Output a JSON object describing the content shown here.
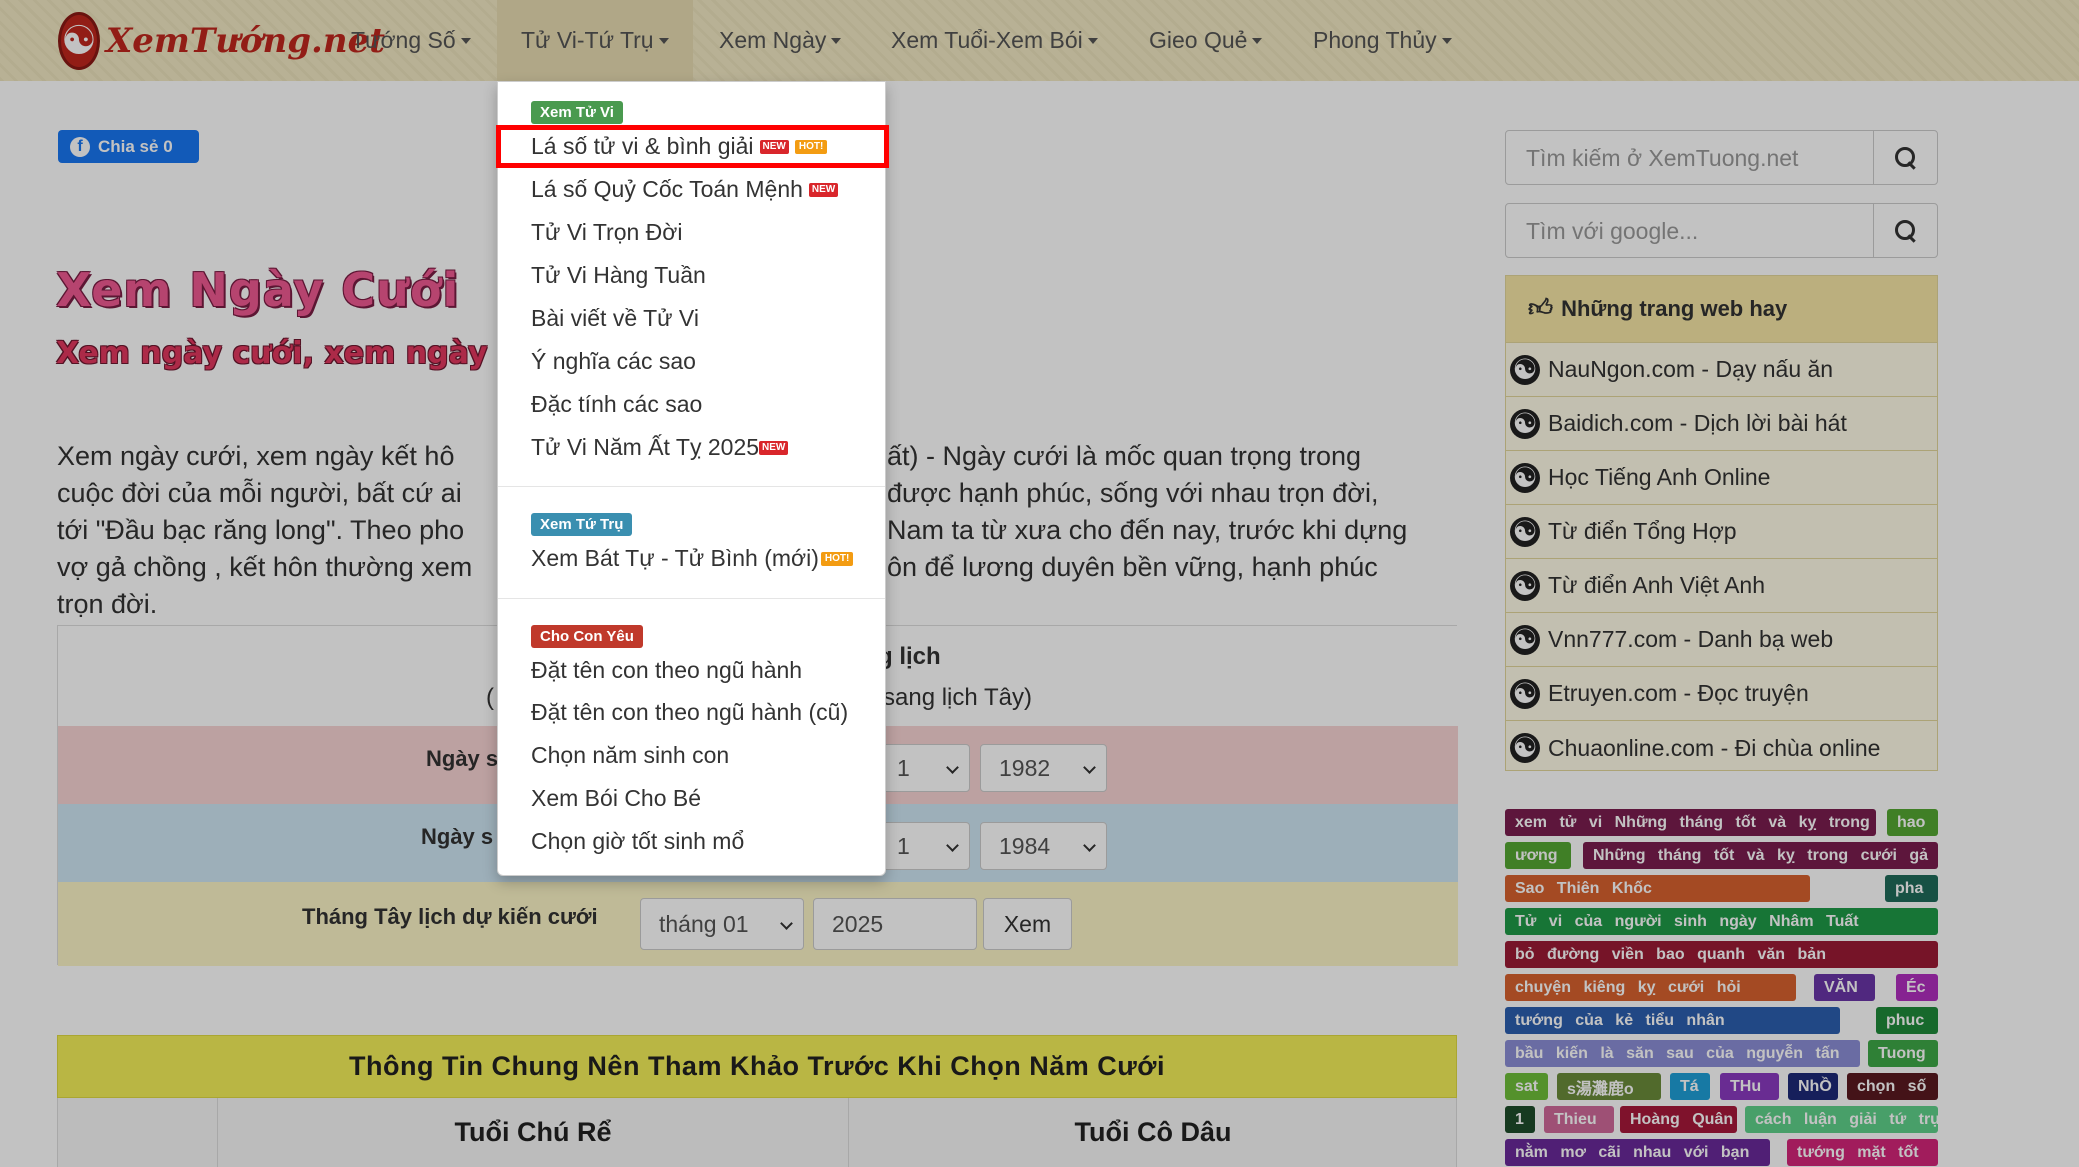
{
  "nav": {
    "logo_text": "XemTướng.net",
    "items": [
      {
        "label": "Tướng Số"
      },
      {
        "label": "Tử Vi-Tứ Trụ"
      },
      {
        "label": "Xem Ngày"
      },
      {
        "label": "Xem Tuổi-Xem Bói"
      },
      {
        "label": "Gieo Quẻ"
      },
      {
        "label": "Phong Thủy"
      }
    ]
  },
  "share": {
    "label": "Chia sẻ 0"
  },
  "page": {
    "title": "Xem Ngày Cưới",
    "subtitle": "Xem ngày cưới, xem ngày kết",
    "intro_lines": [
      "Xem ngày cưới, xem ngày kết hô",
      "cuộc đời của mỗi người, bất cứ ai",
      "tới \"Đầu bạc răng long\". Theo pho",
      "vợ gả chồng , kết hôn thường xem",
      "trọn đời."
    ],
    "intro_right_lines": [
      "ất) - Ngày cưới là mốc quan trọng trong",
      "được hạnh phúc, sống với nhau trọn đời,",
      "Nam ta từ xưa cho đến nay, trước khi dựng",
      "ôn để lương duyên bền vững, hạnh phúc"
    ]
  },
  "form": {
    "head_title": "g lịch",
    "head_note_left": "(",
    "head_note_right": "sang lịch Tây)",
    "groom_label": "Ngày s",
    "groom_month": "1",
    "groom_year": "1982",
    "bride_label": "Ngày s",
    "bride_month": "1",
    "bride_year": "1984",
    "date_label": "Tháng Tây lịch dự kiến cưới",
    "date_month": "tháng 01",
    "date_year": "2025",
    "submit_label": "Xem"
  },
  "info": {
    "bar_title": "Thông Tin Chung Nên Tham Khảo Trước Khi Chọn Năm Cưới",
    "col_groom": "Tuổi Chú Rể",
    "col_bride": "Tuổi Cô Dâu"
  },
  "sidebar": {
    "search_placeholder": "Tìm kiếm ở XemTuong.net",
    "google_placeholder": "Tìm với google...",
    "sites_title": "Những trang web hay",
    "sites": [
      "NauNgon.com - Dạy nấu ăn",
      "Baidich.com - Dịch lời bài hát",
      "Học Tiếng Anh Online",
      "Từ điển Tổng Hợp",
      "Từ điển Anh Việt Anh",
      "Vnn777.com - Danh bạ web",
      "Etruyen.com - Đọc truyện",
      "Chuaonline.com - Đi chùa online"
    ],
    "tags": [
      "xem tử vi Những tháng tốt và kỵ trong",
      "hao",
      "ương",
      "Những tháng tốt và kỵ trong cưới gả",
      "Sao Thiên Khốc",
      "pha",
      "Tử vi của người sinh ngày Nhâm Tuất",
      "bỏ đường viền bao quanh văn bản",
      "chuyện kiêng kỵ cưới hỏi",
      "VĂN",
      "Éc",
      "tướng của kẻ tiểu nhân",
      "phuc",
      "bầu kiến là săn sau của nguyễn tấn",
      "Tuong",
      "sat",
      "s湯灘鹿o",
      "Tá",
      "THu",
      "NhỒ",
      "chọn số",
      "1",
      "Thieu",
      "Hoàng Quân",
      "cách luận giải tứ trụ",
      "nằm mơ cãi nhau với bạn",
      "tướng mặt tốt"
    ]
  },
  "dropdown": {
    "section1": "Xem Tử Vi",
    "items1": [
      "Lá số tử vi & bình giải",
      "Lá số Quỷ Cốc Toán Mệnh",
      "Tử Vi Trọn Đời",
      "Tử Vi Hàng Tuần",
      "Bài viết về Tử Vi",
      "Ý nghĩa các sao",
      "Đặc tính các sao",
      "Tử Vi Năm Ất Tỵ 2025"
    ],
    "section2": "Xem Tứ Trụ",
    "items2": [
      "Xem Bát Tự - Tử Bình (mới)"
    ],
    "section3": "Cho Con Yêu",
    "items3": [
      "Đặt tên con theo ngũ hành",
      "Đặt tên con theo ngũ hành (cũ)",
      "Chọn năm sinh con",
      "Xem Bói Cho Bé",
      "Chọn giờ tốt sinh mổ"
    ],
    "badge_new": "NEW",
    "badge_hot": "HOT!"
  },
  "colors": {
    "nav_bg": "#f2e9c4",
    "title_pink": "#f05a93",
    "label_green": "#4a9a4f",
    "label_teal": "#3a8fb0",
    "label_red": "#c0392b",
    "highlight_red": "#ff0000",
    "share_blue": "#1877f2"
  },
  "icons": [
    "yin-yang-icon",
    "facebook-icon",
    "search-icon",
    "thumbs-up-icon",
    "caret-down-icon",
    "chevron-down-icon"
  ]
}
